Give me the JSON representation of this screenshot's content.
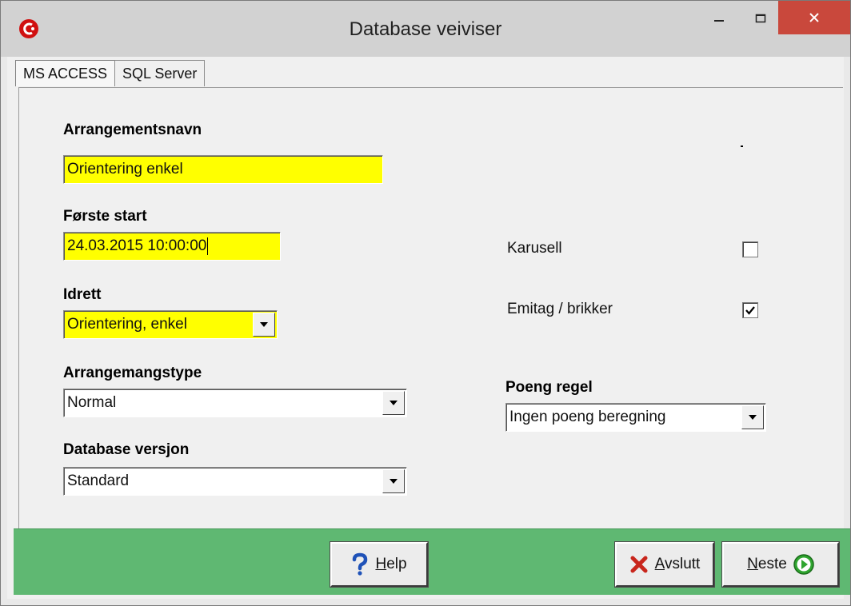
{
  "window": {
    "title": "Database veiviser",
    "controls": {
      "minimize": "–",
      "maximize": "☐",
      "close": "✕"
    }
  },
  "tabs": [
    {
      "label": "MS ACCESS",
      "active": true
    },
    {
      "label": "SQL Server",
      "active": false
    }
  ],
  "form": {
    "arrangementsnavn": {
      "label": "Arrangementsnavn",
      "value": "Orientering enkel"
    },
    "forste_start": {
      "label": "Første start",
      "value": "24.03.2015 10:00:00"
    },
    "idrett": {
      "label": "Idrett",
      "value": "Orientering, enkel"
    },
    "arrangementstype": {
      "label": "Arrangemangstype",
      "value": "Normal"
    },
    "database_versjon": {
      "label": "Database versjon",
      "value": "Standard"
    },
    "karusell": {
      "label": "Karusell",
      "checked": false
    },
    "emitag": {
      "label": "Emitag / brikker",
      "checked": true
    },
    "poeng_regel": {
      "label": "Poeng regel",
      "value": "Ingen poeng beregning"
    }
  },
  "buttons": {
    "help": {
      "mnemonic": "H",
      "rest": "elp",
      "icon": "help-question-icon"
    },
    "avslutt": {
      "mnemonic": "A",
      "rest": "vslutt",
      "icon": "red-x-icon"
    },
    "neste": {
      "mnemonic": "N",
      "rest": "este",
      "icon": "green-next-arrow-icon"
    }
  },
  "colors": {
    "required_field": "#ffff00",
    "footer": "#5fb872",
    "close_button": "#c9483c"
  }
}
